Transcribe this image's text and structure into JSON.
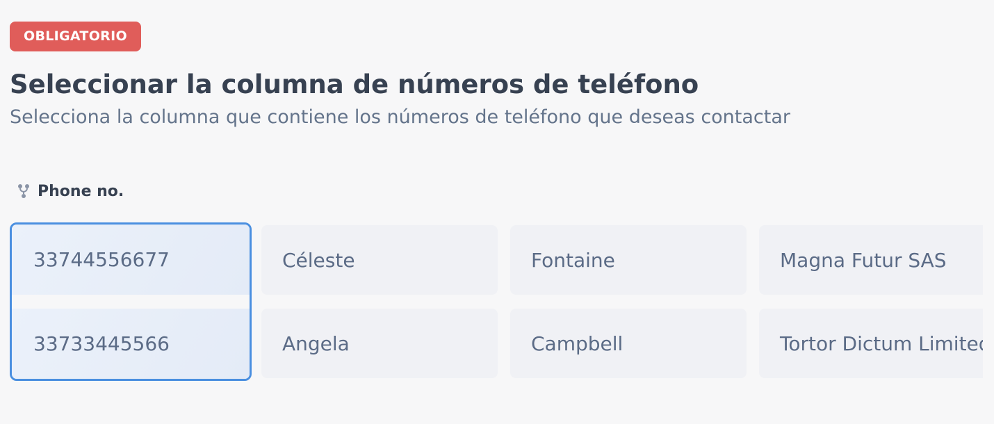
{
  "badge": {
    "label": "OBLIGATORIO",
    "color": "#e05d5a"
  },
  "header": {
    "title": "Seleccionar la columna de números de teléfono",
    "subtitle": "Selecciona la columna que contiene los números de teléfono que deseas contactar"
  },
  "column_selector": {
    "icon": "fork-icon",
    "label": "Phone no.",
    "selected_column": 0,
    "accent_color": "#4a8fe0"
  },
  "columns": [
    {
      "rows": [
        "33744556677",
        "33733445566"
      ]
    },
    {
      "rows": [
        "Céleste",
        "Angela"
      ]
    },
    {
      "rows": [
        "Fontaine",
        "Campbell"
      ]
    },
    {
      "rows": [
        "Magna Futur SAS",
        "Tortor Dictum Limited"
      ]
    }
  ]
}
